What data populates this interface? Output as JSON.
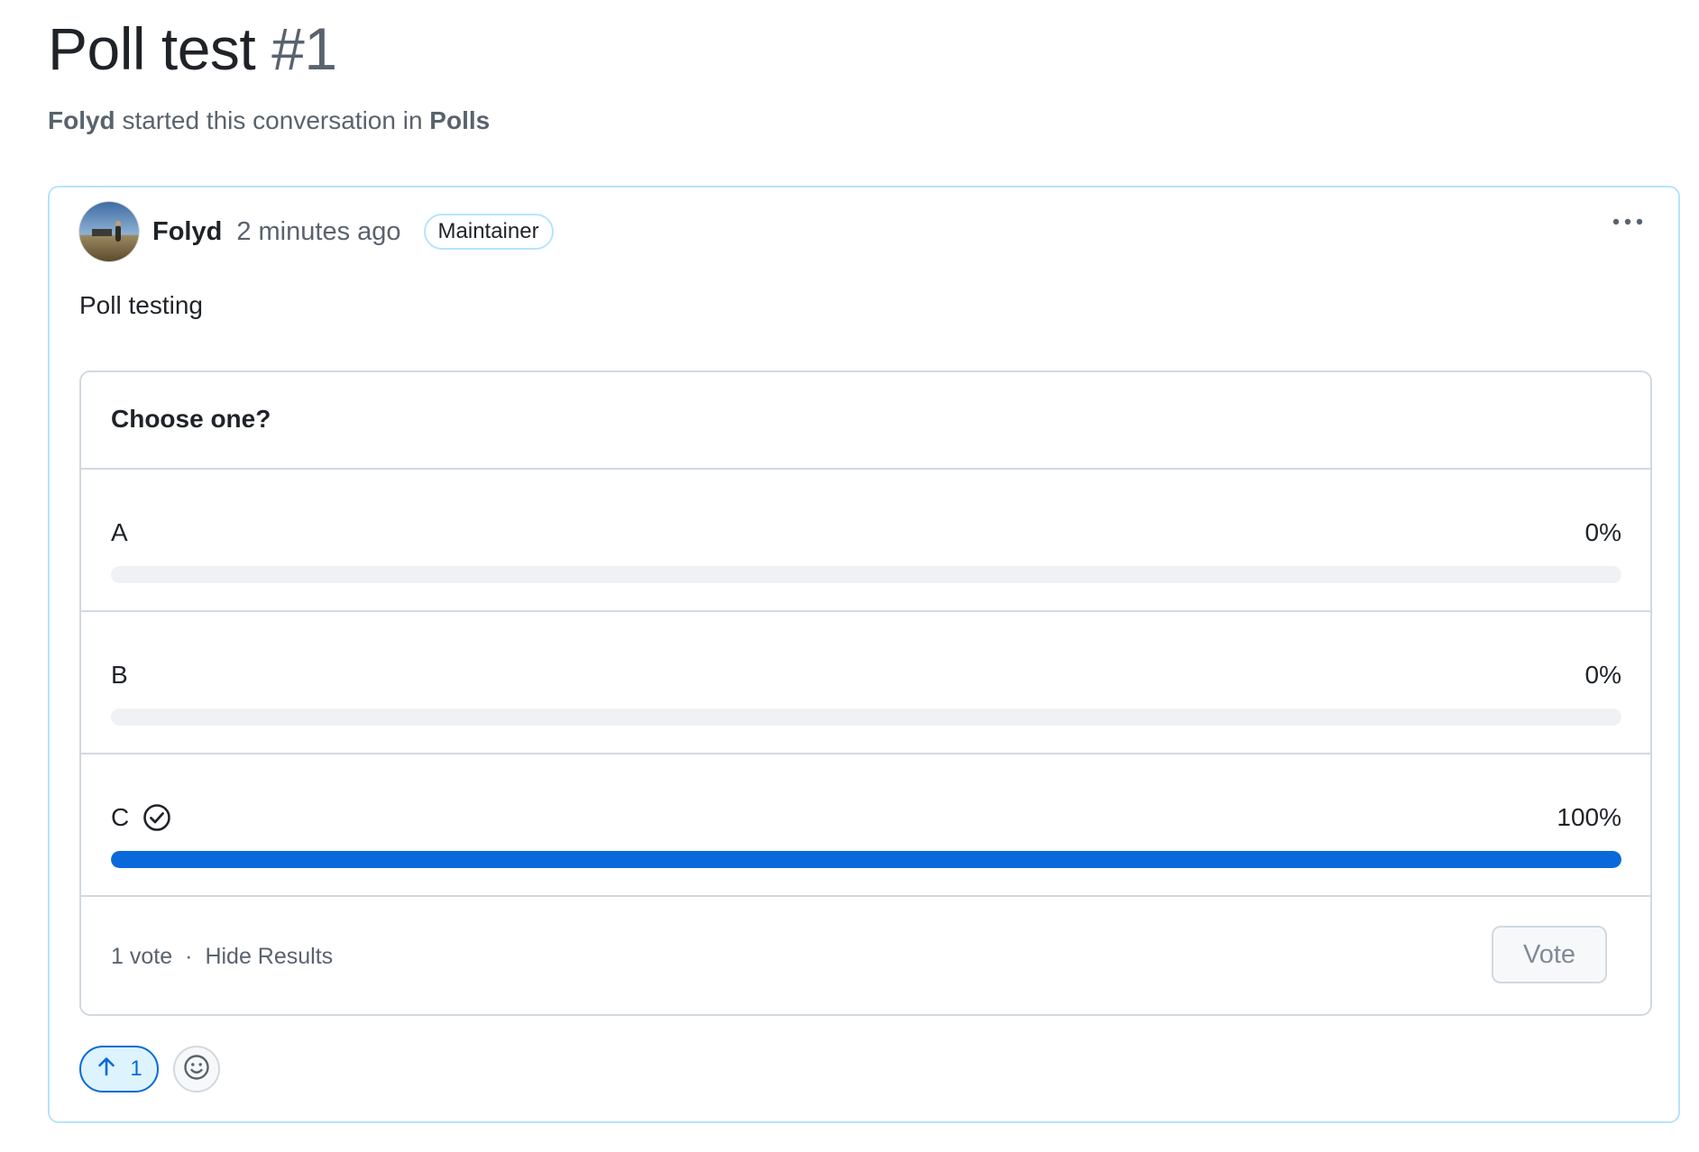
{
  "discussion": {
    "title": "Poll test",
    "number": "#1",
    "author": "Folyd",
    "started_text": "started this conversation in",
    "category": "Polls"
  },
  "post": {
    "author": "Folyd",
    "timestamp": "2 minutes ago",
    "role_badge": "Maintainer",
    "body": "Poll testing",
    "more_icon": "kebab-horizontal-icon"
  },
  "poll": {
    "question": "Choose one?",
    "options": [
      {
        "label": "A",
        "percent_text": "0%",
        "percent": 0,
        "selected": false
      },
      {
        "label": "B",
        "percent_text": "0%",
        "percent": 0,
        "selected": false
      },
      {
        "label": "C",
        "percent_text": "100%",
        "percent": 100,
        "selected": true
      }
    ],
    "vote_count": "1 vote",
    "separator": "·",
    "hide_results": "Hide Results",
    "vote_button": "Vote"
  },
  "reactions": {
    "upvote_count": "1",
    "upvote_icon": "arrow-up-icon",
    "add_reaction_icon": "smiley-icon"
  },
  "colors": {
    "accent": "#0969da",
    "border_accent": "#b6e3ff",
    "muted_text": "#59636e"
  }
}
